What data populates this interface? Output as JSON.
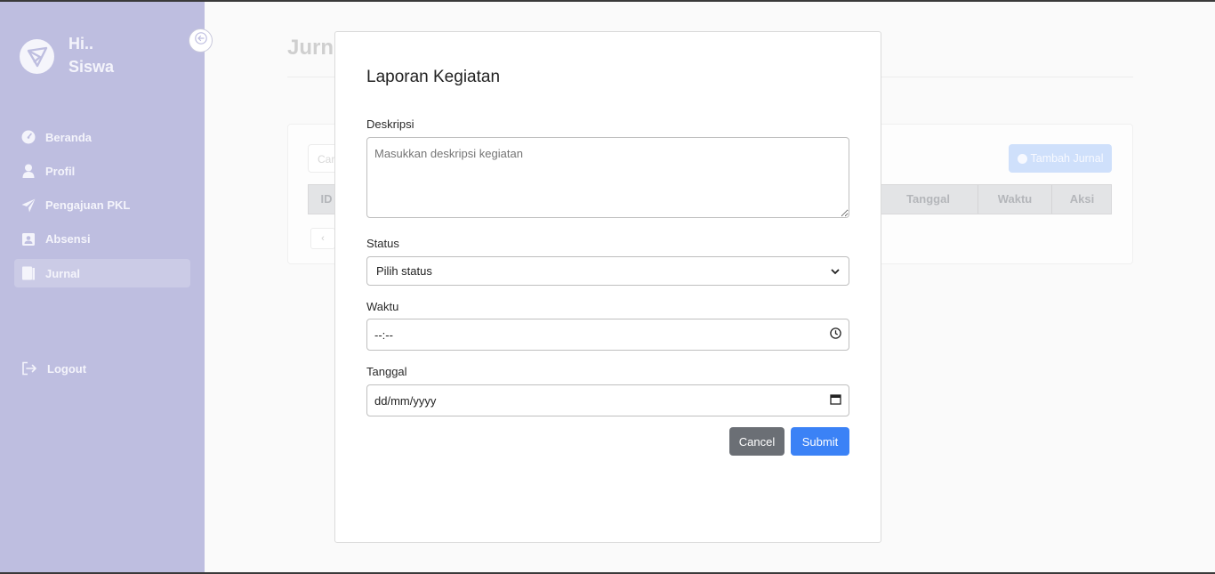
{
  "sidebar": {
    "greeting_line1": "Hi..",
    "greeting_line2": "Siswa",
    "items": [
      {
        "label": "Beranda",
        "icon": "gauge-icon"
      },
      {
        "label": "Profil",
        "icon": "user-icon"
      },
      {
        "label": "Pengajuan PKL",
        "icon": "paper-plane-icon"
      },
      {
        "label": "Absensi",
        "icon": "id-badge-icon"
      },
      {
        "label": "Jurnal",
        "icon": "book-icon",
        "active": true
      }
    ],
    "logout_label": "Logout",
    "colors": {
      "background": "#bebee0",
      "active": "#cbcbe6",
      "text": "#f4f4fb"
    }
  },
  "main": {
    "page_title": "Jurn",
    "search_placeholder": "Car",
    "add_button_label": "Tambah Jurnal",
    "table_headers": [
      "ID",
      "Tanggal",
      "Waktu",
      "Aksi"
    ],
    "pager_label": "‹"
  },
  "modal": {
    "title": "Laporan Kegiatan",
    "deskripsi": {
      "label": "Deskripsi",
      "placeholder": "Masukkan deskripsi kegiatan",
      "value": ""
    },
    "status": {
      "label": "Status",
      "selected": "Pilih status"
    },
    "waktu": {
      "label": "Waktu",
      "value": "--:--"
    },
    "tanggal": {
      "label": "Tanggal",
      "value": "dd/mm/yyyy"
    },
    "cancel_label": "Cancel",
    "submit_label": "Submit",
    "colors": {
      "cancel": "#6b6f75",
      "submit": "#3b82f6"
    }
  }
}
